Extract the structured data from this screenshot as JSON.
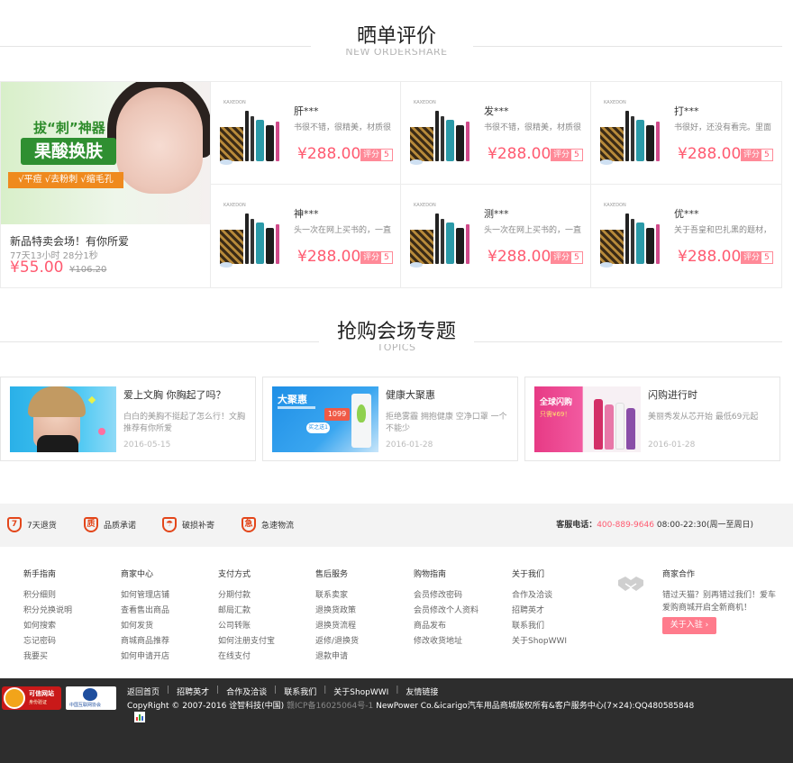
{
  "share": {
    "title": "晒单评价",
    "subtitle": "NEW ORDERSHARE",
    "promo": {
      "image_text1": "拔“刺”神器",
      "image_text2": "果酸换肤",
      "image_text3": "√平痘 √去粉刺 √缩毛孔",
      "name": "新品特卖会场！有你所爱",
      "time": "77天13小时 28分1秒",
      "price": "¥55.00",
      "old_price": "¥106.20"
    },
    "brand": "KAXEDON",
    "score_label": "评分",
    "items": [
      {
        "user": "肝***",
        "comment": "书很不错，很精美，材质很",
        "price": "¥288.00",
        "score": "5"
      },
      {
        "user": "发***",
        "comment": "书很不错，很精美，材质很",
        "price": "¥288.00",
        "score": "5"
      },
      {
        "user": "打***",
        "comment": "书很好，还没有看完。里面",
        "price": "¥288.00",
        "score": "5"
      },
      {
        "user": "神***",
        "comment": "头一次在网上买书的，一直",
        "price": "¥288.00",
        "score": "5"
      },
      {
        "user": "测***",
        "comment": "头一次在网上买书的，一直",
        "price": "¥288.00",
        "score": "5"
      },
      {
        "user": "优***",
        "comment": "关于吾皇和巴扎黑的题材，",
        "price": "¥288.00",
        "score": "5"
      }
    ]
  },
  "topics": {
    "title": "抢购会场专题",
    "subtitle": "TOPICS",
    "items": [
      {
        "title": "爱上文胸 你胸起了吗？",
        "desc": "白白的美胸不挺起了怎么行！文胸推荐有你所爱",
        "date": "2016-05-15"
      },
      {
        "title": "健康大聚惠",
        "desc": "拒绝雾霾 拥抱健康 空净口罩 一个不能少",
        "date": "2016-01-28",
        "img_text1": "大聚惠",
        "img_text2": "1099",
        "img_text3": "买之送1"
      },
      {
        "title": "闪购进行时",
        "desc": "美丽秀发从芯开始 最低69元起",
        "date": "2016-01-28",
        "img_text1": "全球闪购",
        "img_text2": "只需¥69！"
      }
    ]
  },
  "service": {
    "items": [
      {
        "icon": "7",
        "label": "7天退货"
      },
      {
        "icon": "质",
        "label": "品质承诺"
      },
      {
        "icon": "☂",
        "label": "破损补寄"
      },
      {
        "icon": "急",
        "label": "急速物流"
      }
    ],
    "hotline_label": "客服电话：",
    "hotline": "400-889-9646",
    "hours": "08:00-22:30(周一至周日)"
  },
  "footer": {
    "columns": [
      {
        "title": "新手指南",
        "links": [
          "积分细则",
          "积分兑换说明",
          "如何搜索",
          "忘记密码",
          "我要买"
        ]
      },
      {
        "title": "商家中心",
        "links": [
          "如何管理店铺",
          "查看售出商品",
          "如何发货",
          "商城商品推荐",
          "如何申请开店"
        ]
      },
      {
        "title": "支付方式",
        "links": [
          "分期付款",
          "邮局汇款",
          "公司转账",
          "如何注册支付宝",
          "在线支付"
        ]
      },
      {
        "title": "售后服务",
        "links": [
          "联系卖家",
          "退换货政策",
          "退换货流程",
          "返修/退换货",
          "退款申请"
        ]
      },
      {
        "title": "购物指南",
        "links": [
          "会员修改密码",
          "会员修改个人资料",
          "商品发布",
          "修改收货地址"
        ]
      },
      {
        "title": "关于我们",
        "links": [
          "合作及洽谈",
          "招聘英才",
          "联系我们",
          "关于ShopWWI"
        ]
      }
    ],
    "merchant_title": "商家合作",
    "merchant_text": "错过天猫？别再错过我们！爱车爱购商城开启全新商机！",
    "merchant_button": "关于入驻 ›"
  },
  "bottom": {
    "badge1_a": "可信网站",
    "badge1_b": "身份验证",
    "badge2": "中国互联网协会",
    "links": [
      "返回首页",
      "招聘英才",
      "合作及洽谈",
      "联系我们",
      "关于ShopWWI",
      "友情链接"
    ],
    "copyright": "CopyRight © 2007-2016 诠智科技(中国)",
    "icp": "赣ICP备16025064号-1",
    "copyright_tail": " NewPower Co.&icarigo汽车用品商城版权所有&客户服务中心(7×24):QQ480585848"
  }
}
